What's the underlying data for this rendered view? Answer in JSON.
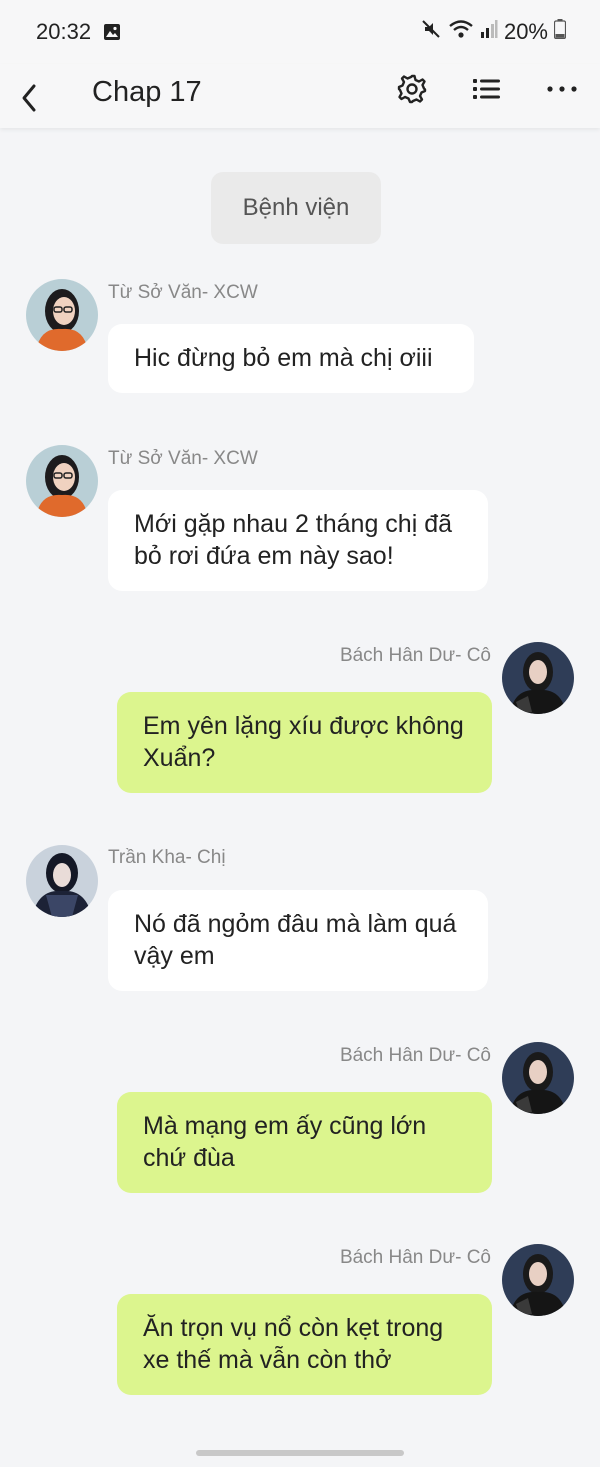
{
  "status_bar": {
    "time": "20:32",
    "battery": "20%",
    "icons": [
      "gallery-icon",
      "mute-icon",
      "wifi-icon",
      "signal-icon",
      "battery-icon"
    ]
  },
  "header": {
    "title": "Chap 17",
    "icons": [
      "back-arrow-icon",
      "gear-icon",
      "list-icon",
      "more-icon"
    ]
  },
  "scene_label": "Bệnh viện",
  "messages": [
    {
      "sender": "Từ Sở Văn- XCW",
      "text": "Hic đừng bỏ em mà chị ơiii",
      "side": "left"
    },
    {
      "sender": "Từ Sở Văn- XCW",
      "text": "Mới gặp nhau 2 tháng chị đã bỏ rơi đứa em này sao!",
      "side": "left"
    },
    {
      "sender": "Bách Hân Dư- Cô",
      "text": "Em yên lặng xíu được không Xuẩn?",
      "side": "right"
    },
    {
      "sender": "Trần Kha- Chị",
      "text": "Nó đã ngỏm đâu mà làm quá vậy em",
      "side": "left"
    },
    {
      "sender": "Bách Hân Dư- Cô",
      "text": "Mà mạng em ấy cũng lớn chứ đùa",
      "side": "right"
    },
    {
      "sender": "Bách Hân Dư- Cô",
      "text": "Ăn trọn vụ nổ còn kẹt trong xe thế mà vẫn còn thở",
      "side": "right"
    }
  ],
  "colors": {
    "background": "#f4f5f7",
    "incoming_bubble": "#ffffff",
    "outgoing_bubble": "#dcf58e",
    "sender_name": "#888888"
  }
}
